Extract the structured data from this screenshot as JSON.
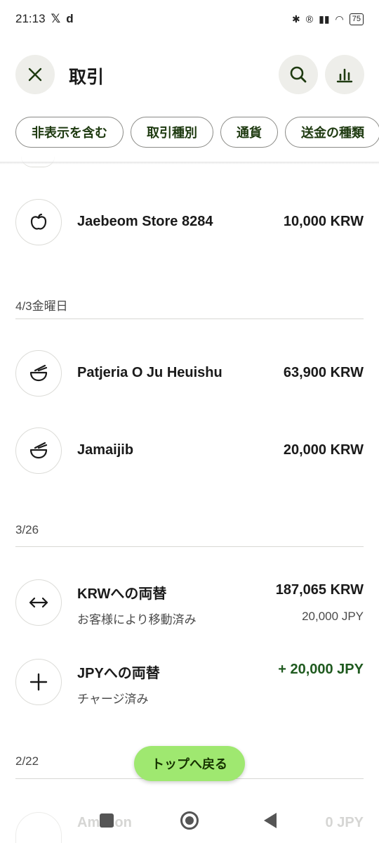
{
  "status_bar": {
    "time": "21:13",
    "icons_left": [
      "x-logo",
      "d-logo"
    ],
    "battery": "75"
  },
  "header": {
    "title": "取引",
    "close_icon": "close-icon",
    "search_icon": "search-icon",
    "stats_icon": "bar-chart-icon"
  },
  "filters": [
    "非表示を含む",
    "取引種別",
    "通貨",
    "送金の種類"
  ],
  "sections": [
    {
      "date": "",
      "items": [
        {
          "name": "Jaebeom Store 8284",
          "amount": "10,000 KRW",
          "icon": "apple-icon"
        }
      ]
    },
    {
      "date": "4/3金曜日",
      "items": [
        {
          "name": "Patjeria O Ju Heuishu",
          "amount": "63,900 KRW",
          "icon": "food-bowl-icon"
        },
        {
          "name": "Jamaijib",
          "amount": "20,000 KRW",
          "icon": "food-bowl-icon"
        }
      ]
    },
    {
      "date": "3/26",
      "items": [
        {
          "name": "KRWへの両替",
          "sub": "お客様により移動済み",
          "amount": "187,065 KRW",
          "sub_amount": "20,000 JPY",
          "icon": "exchange-arrows-icon"
        },
        {
          "name": "JPYへの両替",
          "sub": "チャージ済み",
          "amount": "+ 20,000 JPY",
          "icon": "plus-icon"
        }
      ]
    },
    {
      "date": "2/22",
      "items": [
        {
          "name": "Amazon",
          "amount": "0 JPY",
          "icon": "amazon-icon"
        }
      ]
    }
  ],
  "floating_button": "トップへ戻る",
  "colors": {
    "accent_green": "#9fe870",
    "dark_green": "#163300",
    "positive_amount": "#1f5a1f"
  }
}
